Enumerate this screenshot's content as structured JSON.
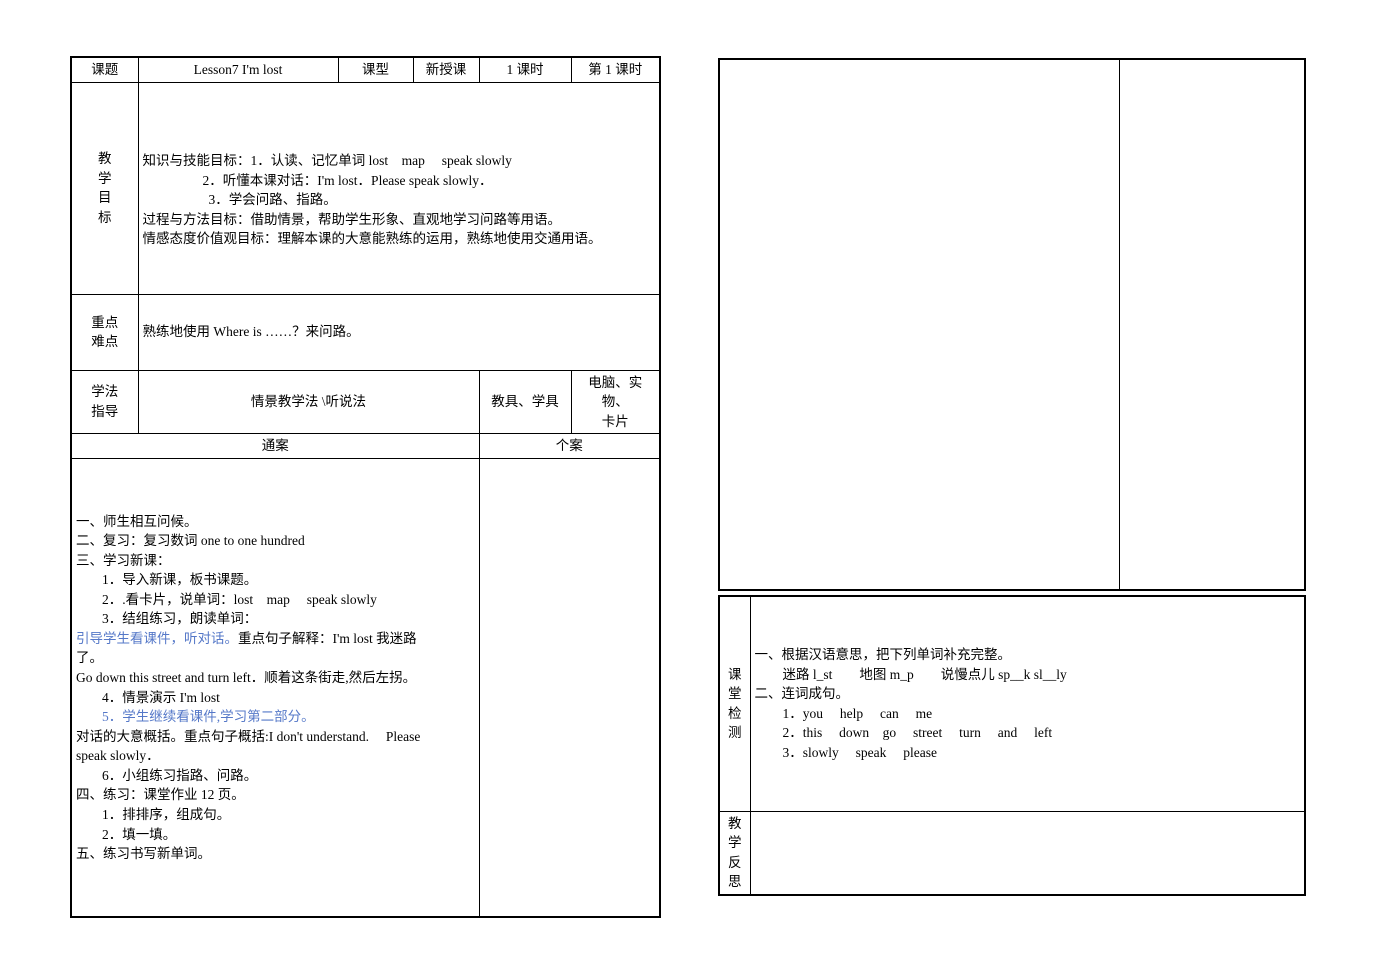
{
  "document": {
    "type": "lesson-plan",
    "blue_accent": "#5578c8",
    "border_color": "#000000"
  },
  "left_table": {
    "header": {
      "topic_label": "课题",
      "topic_value": "Lesson7 I'm lost",
      "type_label": "课型",
      "type_value": "新授课",
      "periods_value": "1 课时",
      "period_no_value": "第 1 课时"
    },
    "goals": {
      "label_chars": [
        "教",
        "学",
        "目",
        "标"
      ],
      "line1": "知识与技能目标：1．认读、记忆单词 lost　map　 speak slowly",
      "line2": "2．听懂本课对话：I'm lost．Please speak slowly．",
      "line3": "3．学会问路、指路。",
      "line4": "过程与方法目标：借助情景，帮助学生形象、直观地学习问路等用语。",
      "line5": "情感态度价值观目标：理解本课的大意能熟练的运用，熟练地使用交通用语。"
    },
    "keypoints": {
      "label_chars": [
        "重点",
        "难点"
      ],
      "text": "熟练地使用 Where is ……？来问路。"
    },
    "method": {
      "label_chars": [
        "学法",
        "指导"
      ],
      "value": "情景教学法 \\听说法",
      "aids_label": "教具、学具",
      "aids_value_line1": "电脑、实物、",
      "aids_value_line2": "卡片"
    },
    "section_headers": {
      "general": "通案",
      "individual": "个案"
    },
    "lesson_body": {
      "lines": [
        {
          "text": "一、师生相互问候。",
          "indent": 0,
          "color": "black"
        },
        {
          "text": "二、复习：复习数词 one to one hundred",
          "indent": 0,
          "color": "black"
        },
        {
          "text": "三、学习新课：",
          "indent": 0,
          "color": "black"
        },
        {
          "text": "1．导入新课，板书课题。",
          "indent": 1,
          "color": "black"
        },
        {
          "text": "2．.看卡片，说单词：lost　map　 speak slowly",
          "indent": 1,
          "color": "black"
        },
        {
          "text": "3．结组练习，朗读单词：",
          "indent": 1,
          "color": "black"
        },
        {
          "text": "引导学生看课件，听对话。",
          "indent": 0,
          "color": "blue",
          "tail": "重点句子解释：I'm lost 我迷路"
        },
        {
          "text": "了。",
          "indent": 0,
          "color": "black"
        },
        {
          "text": "Go down this street and turn left．顺着这条街走,然后左拐。",
          "indent": 0,
          "color": "black"
        },
        {
          "text": "4．情景演示 I'm lost",
          "indent": 1,
          "color": "black"
        },
        {
          "text": "5．学生继续看课件,学习第二部分。",
          "indent": 1,
          "color": "blue"
        },
        {
          "text": "对话的大意概括。重点句子概括:I don't understand.　 Please",
          "indent": 0,
          "color": "black"
        },
        {
          "text": "speak slowly．",
          "indent": 0,
          "color": "black"
        },
        {
          "text": "6．小组练习指路、问路。",
          "indent": 1,
          "color": "black"
        },
        {
          "text": "四、练习：课堂作业 12 页。",
          "indent": 0,
          "color": "black"
        },
        {
          "text": "1．排排序，组成句。",
          "indent": 1,
          "color": "black"
        },
        {
          "text": "2．填一填。",
          "indent": 1,
          "color": "black"
        },
        {
          "text": "五、练习书写新单词。",
          "indent": 0,
          "color": "black"
        }
      ]
    }
  },
  "right_table": {
    "top_blank_left": "",
    "top_blank_right": "",
    "check": {
      "label_chars": [
        "课",
        "堂",
        "检",
        "测"
      ],
      "lines": [
        {
          "text": "一、根据汉语意思，把下列单词补充完整。",
          "indent": 0
        },
        {
          "text": "迷路 l_st　　地图 m_p　　说慢点儿 sp__k sl__ly",
          "indent": 1
        },
        {
          "text": "二、连词成句。",
          "indent": 0
        },
        {
          "text": "1．you　 help　 can　 me",
          "indent": 1
        },
        {
          "text": "2．this　 down　go　 street　 turn　 and　 left",
          "indent": 1
        },
        {
          "text": "3．slowly　 speak　 please",
          "indent": 1
        }
      ]
    },
    "reflection": {
      "label_chars": [
        "教",
        "学",
        "反",
        "思"
      ],
      "content": ""
    }
  }
}
